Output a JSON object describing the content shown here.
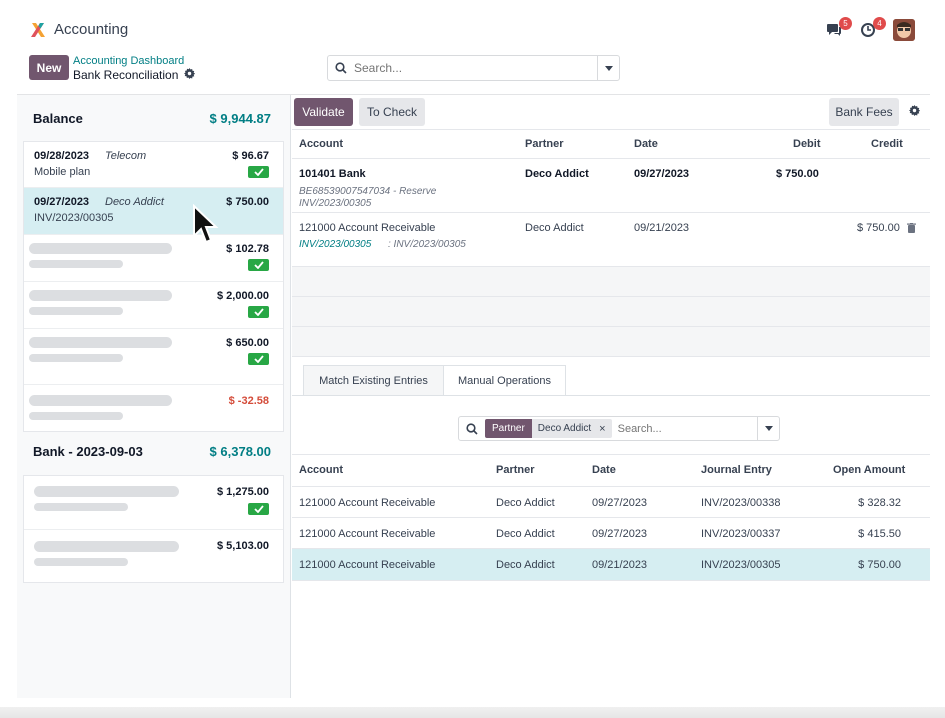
{
  "app": {
    "title": "Accounting"
  },
  "topbar": {
    "messages_count": "5",
    "activity_count": "4"
  },
  "actions": {
    "new_label": "New"
  },
  "breadcrumb": {
    "parent": "Accounting Dashboard",
    "current": "Bank Reconciliation"
  },
  "search": {
    "placeholder": "Search..."
  },
  "left": {
    "balance_label": "Balance",
    "balance_amount": "$ 9,944.87",
    "items": [
      {
        "date": "09/28/2023",
        "partner": "Telecom",
        "label": "Mobile plan",
        "amount": "$ 96.67"
      },
      {
        "date": "09/27/2023",
        "partner": "Deco Addict",
        "label": "INV/2023/00305",
        "amount": "$ 750.00"
      },
      {
        "amount": "$ 102.78"
      },
      {
        "amount": "$ 2,000.00"
      },
      {
        "amount": "$ 650.00"
      },
      {
        "amount": "$ -32.58"
      }
    ],
    "bank_label": "Bank - 2023-09-03",
    "bank_amount": "$ 6,378.00",
    "bank_items": [
      {
        "amount": "$ 1,275.00"
      },
      {
        "amount": "$ 5,103.00"
      }
    ]
  },
  "toolbar": {
    "validate": "Validate",
    "to_check": "To Check",
    "bank_fees": "Bank Fees"
  },
  "entries": {
    "headers": {
      "account": "Account",
      "partner": "Partner",
      "date": "Date",
      "debit": "Debit",
      "credit": "Credit"
    },
    "rows": [
      {
        "account": "101401 Bank",
        "sub1": "BE68539007547034 - Reserve",
        "sub2": "INV/2023/00305",
        "partner": "Deco Addict",
        "date": "09/27/2023",
        "debit": "$ 750.00",
        "credit": ""
      },
      {
        "account": "121000 Account Receivable",
        "sub_link": "INV/2023/00305",
        "sub_rest": ": INV/2023/00305",
        "partner": "Deco Addict",
        "date": "09/21/2023",
        "debit": "",
        "credit": "$ 750.00"
      }
    ]
  },
  "tabs": {
    "match": "Match Existing Entries",
    "manual": "Manual Operations"
  },
  "filter": {
    "facet_label": "Partner",
    "facet_value": "Deco Addict",
    "placeholder": "Search..."
  },
  "match": {
    "headers": {
      "account": "Account",
      "partner": "Partner",
      "date": "Date",
      "journal": "Journal Entry",
      "open": "Open Amount"
    },
    "rows": [
      {
        "account": "121000 Account Receivable",
        "partner": "Deco Addict",
        "date": "09/27/2023",
        "journal": "INV/2023/00338",
        "open": "$ 328.32"
      },
      {
        "account": "121000 Account Receivable",
        "partner": "Deco Addict",
        "date": "09/27/2023",
        "journal": "INV/2023/00337",
        "open": "$ 415.50"
      },
      {
        "account": "121000 Account Receivable",
        "partner": "Deco Addict",
        "date": "09/21/2023",
        "journal": "INV/2023/00305",
        "open": "$ 750.00"
      }
    ]
  }
}
